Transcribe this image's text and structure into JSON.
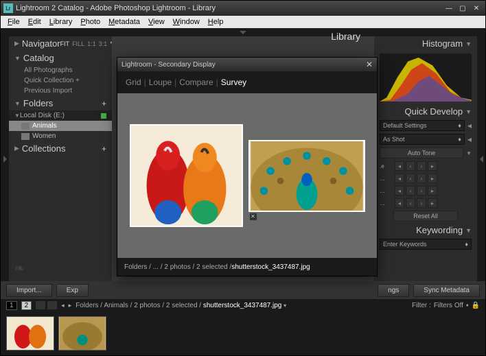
{
  "window": {
    "title": "Lightroom 2 Catalog - Adobe Photoshop Lightroom - Library",
    "app_icon_label": "Lr"
  },
  "menubar": [
    "File",
    "Edit",
    "Library",
    "Photo",
    "Metadata",
    "View",
    "Window",
    "Help"
  ],
  "module": "Library",
  "left": {
    "navigator": {
      "title": "Navigator",
      "modes": [
        "FIT",
        "FILL",
        "1:1",
        "3:1"
      ],
      "active": "FIT"
    },
    "catalog": {
      "title": "Catalog",
      "items": [
        "All Photographs",
        "Quick Collection  +",
        "Previous Import"
      ]
    },
    "folders": {
      "title": "Folders",
      "volume": "Local Disk (E:)",
      "items": [
        {
          "name": "Animals",
          "selected": true
        },
        {
          "name": "Women",
          "selected": false
        }
      ]
    },
    "collections": {
      "title": "Collections"
    }
  },
  "right": {
    "histogram": {
      "title": "Histogram"
    },
    "quickdevelop": {
      "title": "Quick Develop",
      "preset_label": "Default Settings",
      "wb_label": "As Shot",
      "autotone": "Auto Tone",
      "resetall": "Reset All",
      "rows": [
        ".e",
        "…",
        "…",
        "…"
      ]
    },
    "keywording": {
      "title": "Keywording",
      "enter": "Enter Keywords"
    }
  },
  "bottombar": {
    "import": "Import...",
    "export": "Exp",
    "settings": "ngs",
    "sync": "Sync Metadata"
  },
  "pager": {
    "pages": [
      "1",
      "2"
    ],
    "active": "2",
    "crumb_prefix": "Folders / Animals / 2 photos / 2 selected / ",
    "crumb_file": "shutterstock_3437487.jpg",
    "filter_label": "Filter :",
    "filter_value": "Filters Off"
  },
  "secondary": {
    "title": "Lightroom - Secondary Display",
    "tabs": [
      "Grid",
      "Loupe",
      "Compare",
      "Survey"
    ],
    "active": "Survey",
    "footer_prefix": "Folders / ... / 2 photos / 2 selected / ",
    "footer_file": "shutterstock_3437487.jpg"
  },
  "thumbnails": [
    {
      "label": "parrots"
    },
    {
      "label": "peacock"
    }
  ]
}
